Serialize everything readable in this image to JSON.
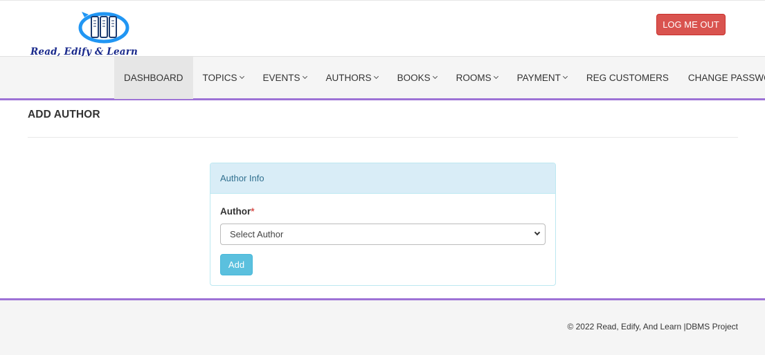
{
  "header": {
    "logo_text": "Read, Edify & Learn",
    "logout_label": "LOG ME OUT"
  },
  "nav": {
    "items": [
      {
        "label": "DASHBOARD",
        "dropdown": false,
        "active": true
      },
      {
        "label": "TOPICS",
        "dropdown": true
      },
      {
        "label": "EVENTS",
        "dropdown": true
      },
      {
        "label": "AUTHORS",
        "dropdown": true
      },
      {
        "label": "BOOKS",
        "dropdown": true
      },
      {
        "label": "ROOMS",
        "dropdown": true
      },
      {
        "label": "PAYMENT",
        "dropdown": true
      },
      {
        "label": "REG CUSTOMERS",
        "dropdown": false
      },
      {
        "label": "CHANGE PASSWORD",
        "dropdown": false
      }
    ]
  },
  "page": {
    "title": "ADD AUTHOR"
  },
  "panel": {
    "heading": "Author Info",
    "field_label": "Author",
    "required_mark": "*",
    "select_value": "Select Author",
    "add_label": "Add"
  },
  "footer": {
    "text": "© 2022 Read, Edify, And Learn |DBMS Project"
  },
  "colors": {
    "accent_purple": "#9d72d6",
    "logout_red": "#d9534f",
    "info_blue": "#5bc0de",
    "panel_heading_bg": "#d9edf7",
    "logo_blue": "#2196f3"
  },
  "icons": [
    "books-logo-icon",
    "chevron-down-icon"
  ]
}
